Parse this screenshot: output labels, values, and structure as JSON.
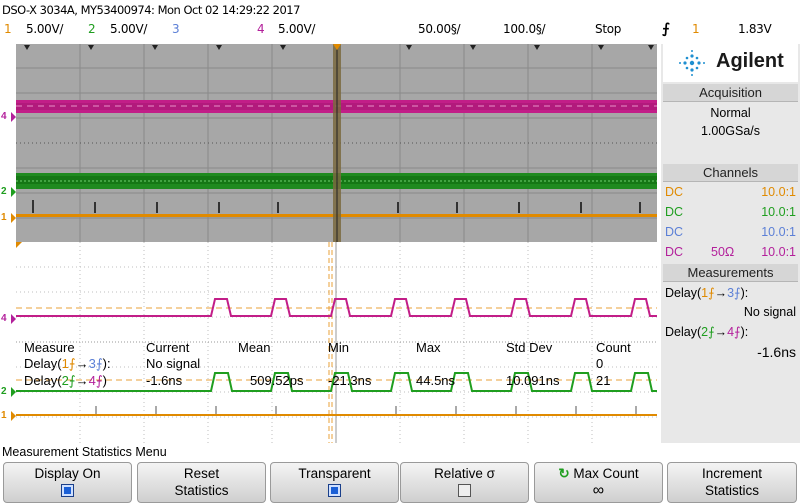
{
  "status": {
    "title": "DSO-X 3034A, MY53400974: Mon Oct 02 14:29:22 2017",
    "ch1": {
      "num": "1",
      "scale": "5.00V/"
    },
    "ch2": {
      "num": "2",
      "scale": "5.00V/"
    },
    "ch3": {
      "num": "3"
    },
    "ch4": {
      "num": "4",
      "scale": "5.00V/"
    },
    "timebase": "50.00§/",
    "zoom_timebase": "100.0§/",
    "run_state": "Stop",
    "trigger_icon": "⨍",
    "trigger_channel": "1",
    "trigger_level": "1.83V"
  },
  "side": {
    "brand": "Agilent",
    "acquisition": {
      "header": "Acquisition",
      "mode": "Normal",
      "rate": "1.00GSa/s"
    },
    "channels": {
      "header": "Channels",
      "rows": [
        {
          "coupling": "DC",
          "imp": "",
          "probe": "10.0:1"
        },
        {
          "coupling": "DC",
          "imp": "",
          "probe": "10.0:1"
        },
        {
          "coupling": "DC",
          "imp": "",
          "probe": "10.0:1"
        },
        {
          "coupling": "DC",
          "imp": "50Ω",
          "probe": "10.0:1"
        }
      ]
    },
    "measurements": {
      "header": "Measurements",
      "m1_label": "Delay(",
      "m1_a": "1⨍",
      "m1_arrow": "→",
      "m1_b": "3⨍",
      "m1_end": "):",
      "m1_value": "No signal",
      "m2_label": "Delay(",
      "m2_a": "2⨍",
      "m2_arrow": "→",
      "m2_b": "4⨍",
      "m2_end": "):",
      "m2_value": "-1.6ns"
    }
  },
  "stats": {
    "headers": [
      "Measure",
      "Current",
      "Mean",
      "Min",
      "Max",
      "Std Dev",
      "Count"
    ],
    "row1": {
      "name": "Delay(",
      "a": "1⨍",
      "arrow": "→",
      "b": "3⨍",
      "end": "):",
      "current": "No signal",
      "mean": "",
      "min": "",
      "max": "",
      "stddev": "",
      "count": "0"
    },
    "row2": {
      "name": "Delay(",
      "a": "2⨍",
      "arrow": "→",
      "b": "4⨍",
      "end": ")",
      "current": "-1.6ns",
      "mean": "509.52ps",
      "min": "-21.3ns",
      "max": "44.5ns",
      "stddev": "10.091ns",
      "count": "21"
    }
  },
  "level_markers": {
    "ch4": "4",
    "ch2": "2",
    "ch1": "1"
  },
  "menu": {
    "title": "Measurement Statistics Menu",
    "display_on": "Display On",
    "reset_1": "Reset",
    "reset_2": "Statistics",
    "transparent": "Transparent",
    "relative": "Relative σ",
    "max_count": "Max Count",
    "max_count_value": "∞",
    "increment_1": "Increment",
    "increment_2": "Statistics"
  },
  "colors": {
    "ch1": "#e08a00",
    "ch2": "#1f9e1f",
    "ch3": "#5b7fd6",
    "ch4": "#b3209b"
  }
}
